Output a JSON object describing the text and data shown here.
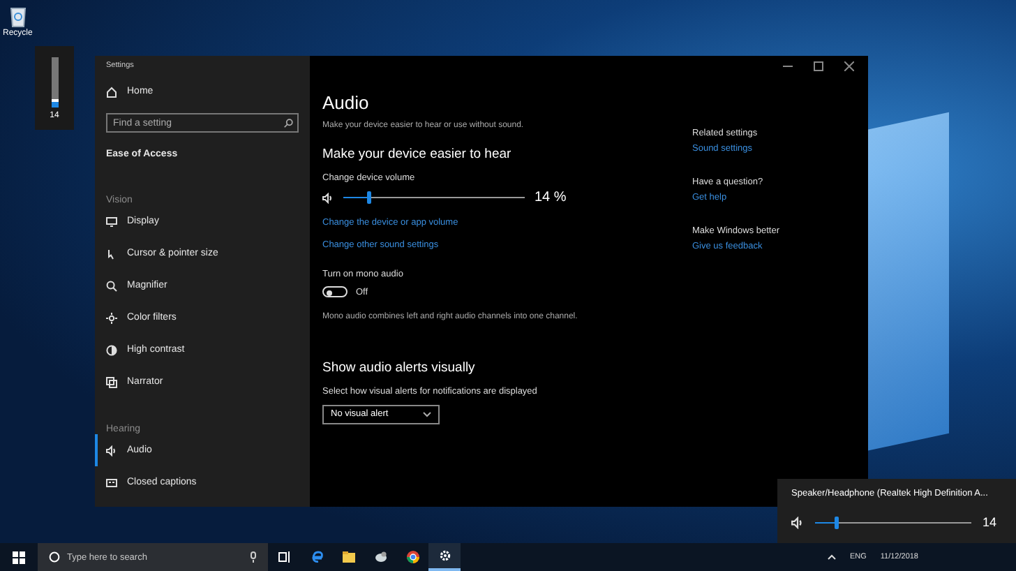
{
  "desktop_icons": [
    {
      "label": "Recycle"
    }
  ],
  "volume_osd": {
    "level": 0.14,
    "reading": "14"
  },
  "window": {
    "title": "Settings"
  },
  "sidebar": {
    "home": "Home",
    "search_placeholder": "Find a setting",
    "section": "Ease of Access",
    "groups": [
      {
        "heading": "Vision",
        "items": [
          {
            "label": "Display",
            "selected": false
          },
          {
            "label": "Cursor & pointer size",
            "selected": false
          },
          {
            "label": "Magnifier",
            "selected": false
          },
          {
            "label": "Color filters",
            "selected": false
          },
          {
            "label": "High contrast",
            "selected": false
          },
          {
            "label": "Narrator",
            "selected": false
          }
        ]
      },
      {
        "heading": "Hearing",
        "items": [
          {
            "label": "Audio",
            "selected": true
          },
          {
            "label": "Closed captions",
            "selected": false
          }
        ]
      }
    ]
  },
  "content": {
    "title": "Audio",
    "subtitle": "Make your device easier to hear or use without sound.",
    "section_1": "Make your device easier to hear",
    "volume_label": "Change device volume",
    "volume": {
      "level": 0.14,
      "reading": "14 %"
    },
    "links": [
      "Change the device or app volume",
      "Change other sound settings"
    ],
    "mono": {
      "label": "Turn on mono audio",
      "on": false,
      "state": "Off",
      "description": "Mono audio combines left and right audio channels into one channel."
    },
    "section_2": "Show audio alerts visually",
    "alerts_label": "Select how visual alerts for notifications are displayed",
    "alerts_value": "No visual alert"
  },
  "related": [
    {
      "heading": "Related settings",
      "link": "Sound settings"
    },
    {
      "heading": "Have a question?",
      "link": "Get help"
    },
    {
      "heading": "Make Windows better",
      "link": "Give us feedback"
    }
  ],
  "flyout": {
    "device": "Speaker/Headphone (Realtek High Definition A...",
    "level": 0.14,
    "reading": "14"
  },
  "taskbar": {
    "search_placeholder": "Type here to search",
    "apps": [
      {
        "selected": false
      },
      {
        "selected": false
      },
      {
        "selected": false
      },
      {
        "selected": false
      },
      {
        "selected": false
      },
      {
        "selected": true
      }
    ],
    "language": "ENG",
    "date": "11/12/2018"
  }
}
